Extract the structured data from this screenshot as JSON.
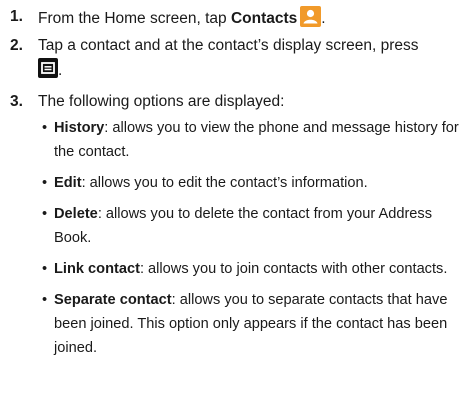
{
  "steps": [
    {
      "number": "1.",
      "prefix": "From the Home screen, tap ",
      "bold": "Contacts",
      "icon": "contacts-app-icon",
      "suffix": "."
    },
    {
      "number": "2.",
      "text": "Tap a contact and at the contact’s display screen, press",
      "icon": "menu-key-icon",
      "suffix": "."
    },
    {
      "number": "3.",
      "text": "The following options are displayed:"
    }
  ],
  "options": [
    {
      "term": "History",
      "desc": ": allows you to view the phone and message history for the contact."
    },
    {
      "term": "Edit",
      "desc": ": allows you to edit the contact’s information."
    },
    {
      "term": "Delete",
      "desc": ": allows you to delete the contact from your Address Book."
    },
    {
      "term": "Link contact",
      "desc": ": allows you to join contacts with other contacts."
    },
    {
      "term": "Separate contact",
      "desc": ": allows you to separate contacts that have been joined. This option only appears if the contact has been joined."
    }
  ],
  "bullet_glyph": "•",
  "colors": {
    "contacts_icon": "#f19a2a",
    "menu_icon": "#111111"
  }
}
